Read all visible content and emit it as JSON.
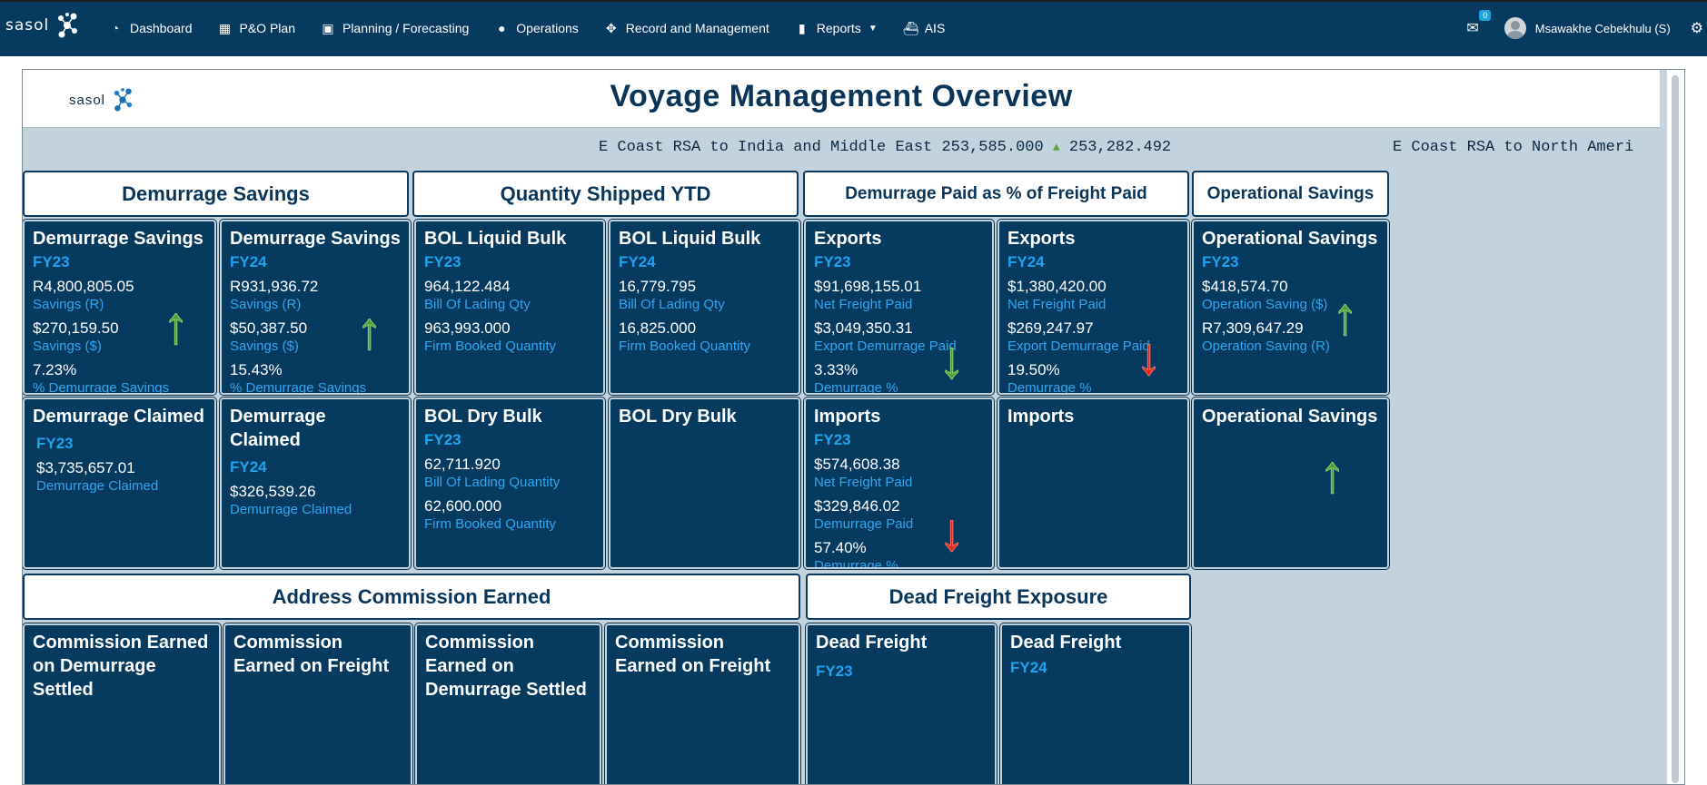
{
  "nav": {
    "brand": "sasol",
    "items": [
      {
        "label": "Dashboard",
        "icon": "tachometer-icon"
      },
      {
        "label": "P&O Plan",
        "icon": "calendar-icon"
      },
      {
        "label": "Planning / Forecasting",
        "icon": "calendar-check-icon"
      },
      {
        "label": "Operations",
        "icon": "users-cog-icon"
      },
      {
        "label": "Record and Management",
        "icon": "arrows-icon"
      },
      {
        "label": "Reports",
        "icon": "file-icon"
      },
      {
        "label": "AIS",
        "icon": "ship-icon"
      }
    ],
    "mail_count": "0",
    "user_name": "Msawakhe Cebekhulu (S)"
  },
  "header": {
    "brand": "sasol",
    "title": "Voyage Management Overview"
  },
  "ticker": {
    "item1_route": "E Coast RSA to India and Middle East",
    "item1_v1": "253,585.000",
    "item1_v2": "253,282.492",
    "item2_route": "E Coast RSA to North Ameri"
  },
  "sections": {
    "demurrage_savings": "Demurrage Savings",
    "quantity_shipped": "Quantity Shipped YTD",
    "demurrage_paid": "Demurrage Paid as % of Freight Paid",
    "operational_savings": "Operational Savings",
    "address_commission": "Address Commission Earned",
    "dead_freight": "Dead Freight Exposure"
  },
  "cards": {
    "ds23": {
      "title": "Demurrage Savings",
      "fy": "FY23",
      "v1": "R4,800,805.05",
      "l1": "Savings (R)",
      "v2": "$270,159.50",
      "l2": "Savings ($)",
      "v3": "7.23%",
      "l3": "% Demurrage Savings"
    },
    "ds24": {
      "title": "Demurrage Savings",
      "fy": "FY24",
      "v1": "R931,936.72",
      "l1": "Savings (R)",
      "v2": "$50,387.50",
      "l2": "Savings ($)",
      "v3": "15.43%",
      "l3": "% Demurrage Savings"
    },
    "bl23": {
      "title": "BOL Liquid Bulk",
      "fy": "FY23",
      "v1": "964,122.484",
      "l1": "Bill Of Lading Qty",
      "v2": "963,993.000",
      "l2": "Firm Booked Quantity"
    },
    "bl24": {
      "title": "BOL Liquid Bulk",
      "fy": "FY24",
      "v1": "16,779.795",
      "l1": "Bill Of Lading Qty",
      "v2": "16,825.000",
      "l2": "Firm Booked Quantity"
    },
    "ex23": {
      "title": "Exports",
      "fy": "FY23",
      "v1": "$91,698,155.01",
      "l1": "Net Freight Paid",
      "v2": "$3,049,350.31",
      "l2": "Export Demurrage Paid",
      "v3": "3.33%",
      "l3": "Demurrage %"
    },
    "ex24": {
      "title": "Exports",
      "fy": "FY24",
      "v1": "$1,380,420.00",
      "l1": "Net Freight Paid",
      "v2": "$269,247.97",
      "l2": "Export Demurrage Paid",
      "v3": "19.50%",
      "l3": "Demurrage %"
    },
    "os23": {
      "title": "Operational Savings",
      "fy": "FY23",
      "v1": "$418,574.70",
      "l1": "Operation Saving ($)",
      "v2": "R7,309,647.29",
      "l2": "Operation Saving (R)"
    },
    "dc23": {
      "title": "Demurrage Claimed",
      "fy": "FY23",
      "v1": "$3,735,657.01",
      "l1": "Demurrage Claimed"
    },
    "dc24": {
      "title": "Demurrage Claimed",
      "fy": "FY24",
      "v1": "$326,539.26",
      "l1": "Demurrage Claimed"
    },
    "bd23": {
      "title": "BOL Dry Bulk",
      "fy": "FY23",
      "v1": "62,711.920",
      "l1": "Bill Of Lading Quantity",
      "v2": "62,600.000",
      "l2": "Firm Booked Quantity"
    },
    "bd24": {
      "title": "BOL Dry Bulk"
    },
    "im23": {
      "title": "Imports",
      "fy": "FY23",
      "v1": "$574,608.38",
      "l1": "Net Freight Paid",
      "v2": "$329,846.02",
      "l2": "Demurrage Paid",
      "v3": "57.40%",
      "l3": "Demurrage %"
    },
    "im24": {
      "title": "Imports"
    },
    "os24": {
      "title": "Operational Savings"
    },
    "ce1": {
      "title": "Commission Earned on Demurrage Settled"
    },
    "ce2": {
      "title": "Commission Earned on Freight"
    },
    "ce3": {
      "title": "Commission Earned on Demurrage Settled"
    },
    "ce4": {
      "title": "Commission Earned on Freight"
    },
    "df23": {
      "title": "Dead Freight",
      "fy": "FY23"
    },
    "df24": {
      "title": "Dead Freight",
      "fy": "FY24"
    }
  },
  "colors": {
    "navy": "#063a5e",
    "accent": "#1ea3f0",
    "up": "#4f9a3a",
    "down": "#e52218"
  },
  "trend_icons": {
    "ds23": "arrow-up-icon",
    "ds24": "arrow-up-icon",
    "ex23": "arrow-down-icon",
    "ex24": "arrow-down-icon",
    "os23": "arrow-up-icon",
    "im23": "arrow-down-icon",
    "os24": "arrow-up-icon"
  }
}
